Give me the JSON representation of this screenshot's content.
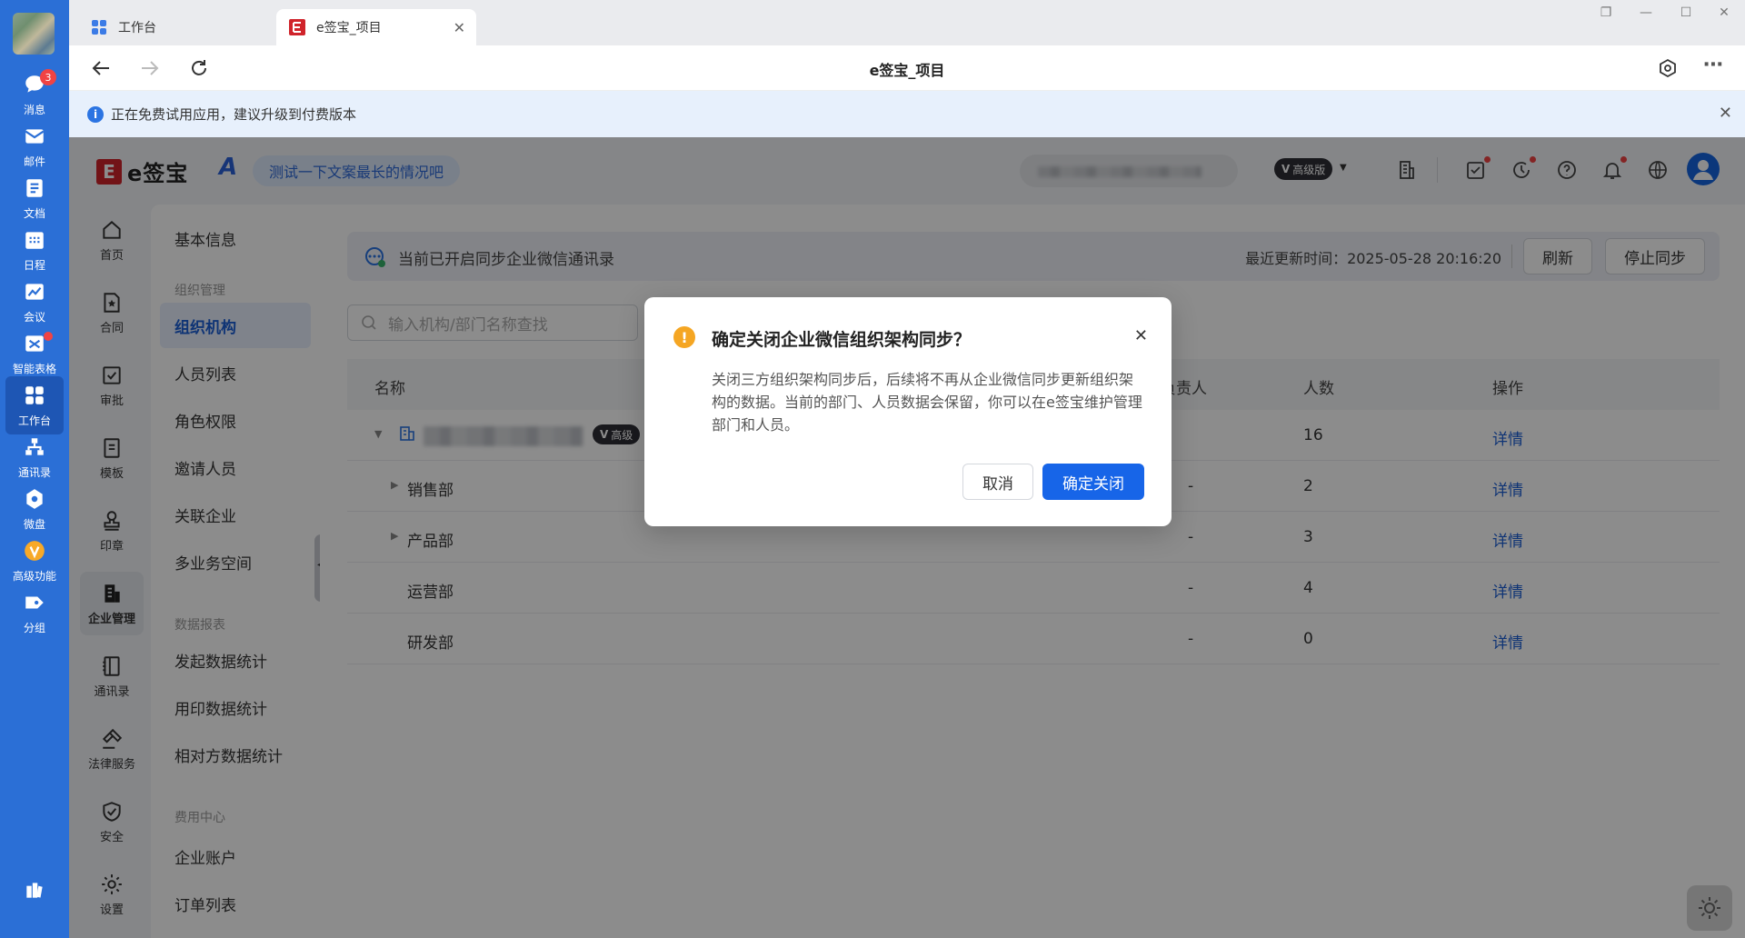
{
  "rail": {
    "items": [
      {
        "label": "消息",
        "icon": "chat-icon",
        "badge": "3"
      },
      {
        "label": "邮件",
        "icon": "mail-icon"
      },
      {
        "label": "文档",
        "icon": "doc-icon"
      },
      {
        "label": "日程",
        "icon": "calendar-icon"
      },
      {
        "label": "会议",
        "icon": "meeting-icon"
      },
      {
        "label": "智能表格",
        "icon": "smart-table-icon"
      },
      {
        "label": "工作台",
        "icon": "workbench-icon"
      },
      {
        "label": "通讯录",
        "icon": "org-icon"
      },
      {
        "label": "微盘",
        "icon": "drive-icon"
      },
      {
        "label": "高级功能",
        "icon": "premium-icon"
      },
      {
        "label": "分组",
        "icon": "tag-icon"
      }
    ],
    "active": "工作台"
  },
  "browser": {
    "tabs": [
      {
        "label": "工作台"
      },
      {
        "label": "e签宝_项目"
      }
    ],
    "page_title": "e签宝_项目"
  },
  "trial_bar": {
    "text": "正在免费试用应用，建议升级到付费版本"
  },
  "app": {
    "logo_text": "e签宝",
    "logo_mark": "E",
    "ai_chip": "测试一下文案最长的情况吧",
    "vip_label": "高级版",
    "side1": [
      {
        "label": "首页",
        "icon": "home-icon"
      },
      {
        "label": "合同",
        "icon": "contract-icon"
      },
      {
        "label": "审批",
        "icon": "approval-icon"
      },
      {
        "label": "模板",
        "icon": "template-icon"
      },
      {
        "label": "印章",
        "icon": "seal-icon"
      },
      {
        "label": "企业管理",
        "icon": "enterprise-icon"
      },
      {
        "label": "通讯录",
        "icon": "contacts-icon"
      },
      {
        "label": "法律服务",
        "icon": "legal-icon"
      },
      {
        "label": "安全",
        "icon": "shield-icon"
      },
      {
        "label": "设置",
        "icon": "gear-icon"
      }
    ],
    "side2": {
      "basic": "基本信息",
      "sec_org": "组织管理",
      "org_items": [
        "组织机构",
        "人员列表",
        "角色权限",
        "邀请人员",
        "关联企业",
        "多业务空间"
      ],
      "sec_data": "数据报表",
      "data_items": [
        "发起数据统计",
        "用印数据统计",
        "相对方数据统计"
      ],
      "sec_fee": "费用中心",
      "fee_items": [
        "企业账户",
        "订单列表"
      ]
    },
    "sync": {
      "message": "当前已开启同步企业微信通讯录",
      "updated": "最近更新时间：2025-05-28 20:16:20",
      "refresh": "刷新",
      "stop": "停止同步"
    },
    "search_placeholder": "输入机构/部门名称查找",
    "table": {
      "headers": {
        "name": "名称",
        "owner": "负责人",
        "count": "人数",
        "action": "操作"
      },
      "root": {
        "tag": "高级",
        "count": "16",
        "action": "详情"
      },
      "rows": [
        {
          "name": "销售部",
          "owner": "-",
          "count": "2",
          "action": "详情",
          "expandable": true
        },
        {
          "name": "产品部",
          "owner": "-",
          "count": "3",
          "action": "详情",
          "expandable": true
        },
        {
          "name": "运营部",
          "owner": "-",
          "count": "4",
          "action": "详情",
          "expandable": false
        },
        {
          "name": "研发部",
          "owner": "-",
          "count": "0",
          "action": "详情",
          "expandable": false
        }
      ]
    }
  },
  "modal": {
    "title": "确定关闭企业微信组织架构同步？",
    "body": "关闭三方组织架构同步后，后续将不再从企业微信同步更新组织架构的数据。当前的部门、人员数据会保留，你可以在e签宝维护管理部门和人员。",
    "cancel": "取消",
    "confirm": "确定关闭"
  },
  "colors": {
    "rail": "#2b6fd6",
    "primary": "#1765e8",
    "warning": "#f5a623",
    "brand_red": "#d0242b"
  }
}
